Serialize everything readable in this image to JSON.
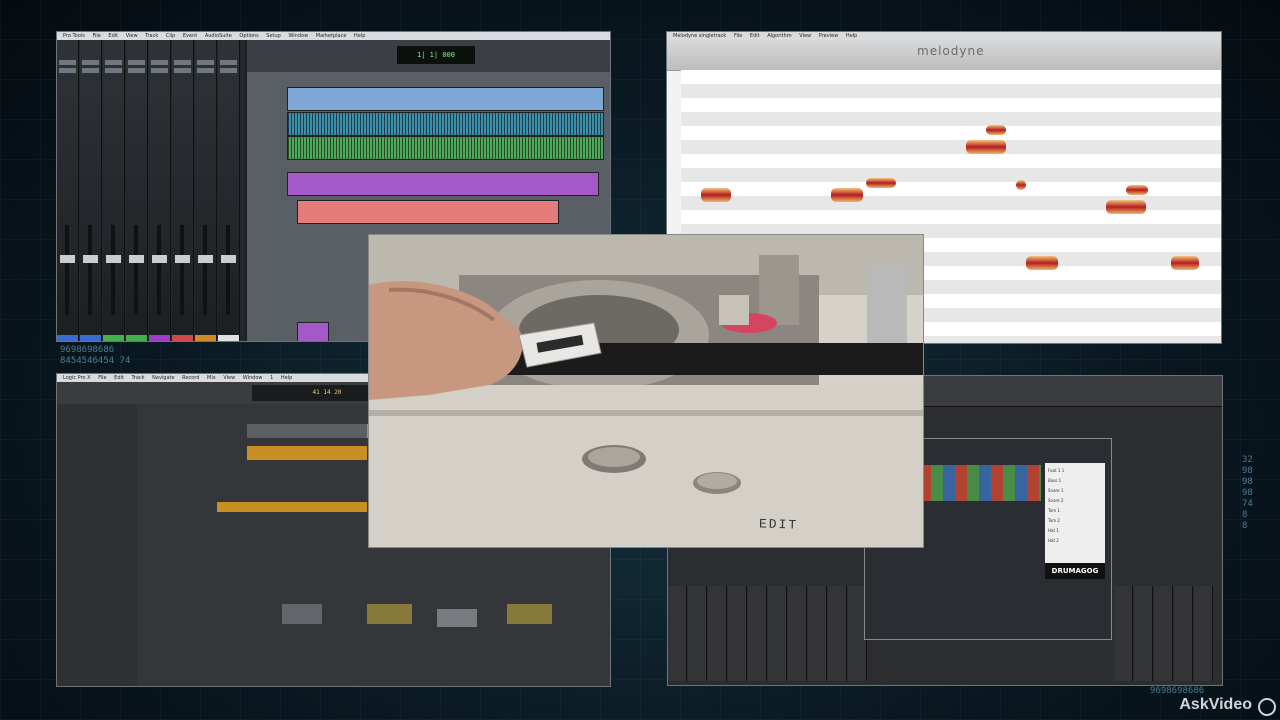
{
  "pro_tools": {
    "menu": [
      "Pro Tools",
      "File",
      "Edit",
      "View",
      "Track",
      "Clip",
      "Event",
      "AudioSuite",
      "Options",
      "Setup",
      "Window",
      "Marketplace",
      "Help"
    ],
    "counter": "1| 1| 000"
  },
  "melodyne": {
    "menu": [
      "Melodyne singletrack",
      "File",
      "Edit",
      "Algorithm",
      "View",
      "Preview",
      "Help"
    ],
    "logo": "melodyne"
  },
  "logic": {
    "menu": [
      "Logic Pro X",
      "File",
      "Edit",
      "Track",
      "Navigate",
      "Record",
      "Mix",
      "View",
      "Window",
      "1",
      "Help"
    ],
    "lcd": "41 14 20"
  },
  "drumagog": {
    "brand": "DRUMAGOG",
    "list_items": [
      "Foot 1 1",
      "Bass 1",
      "Snare 1",
      "Snare 2",
      "Tom 1",
      "Tom 2",
      "Hat 1",
      "Hat 2"
    ]
  },
  "video": {
    "edit_label": "EDIT"
  },
  "background": {
    "digits": [
      "9698698686",
      "8454546454 74",
      "32",
      "98",
      "98",
      "98",
      "74",
      "8",
      "8",
      "9698698686"
    ]
  },
  "watermark": {
    "text": "AskVideo"
  },
  "colors": {
    "melodyne_blob": "#b21e1e",
    "counter_text": "#8ef08a",
    "logic_lcd": "#e8d26a"
  }
}
